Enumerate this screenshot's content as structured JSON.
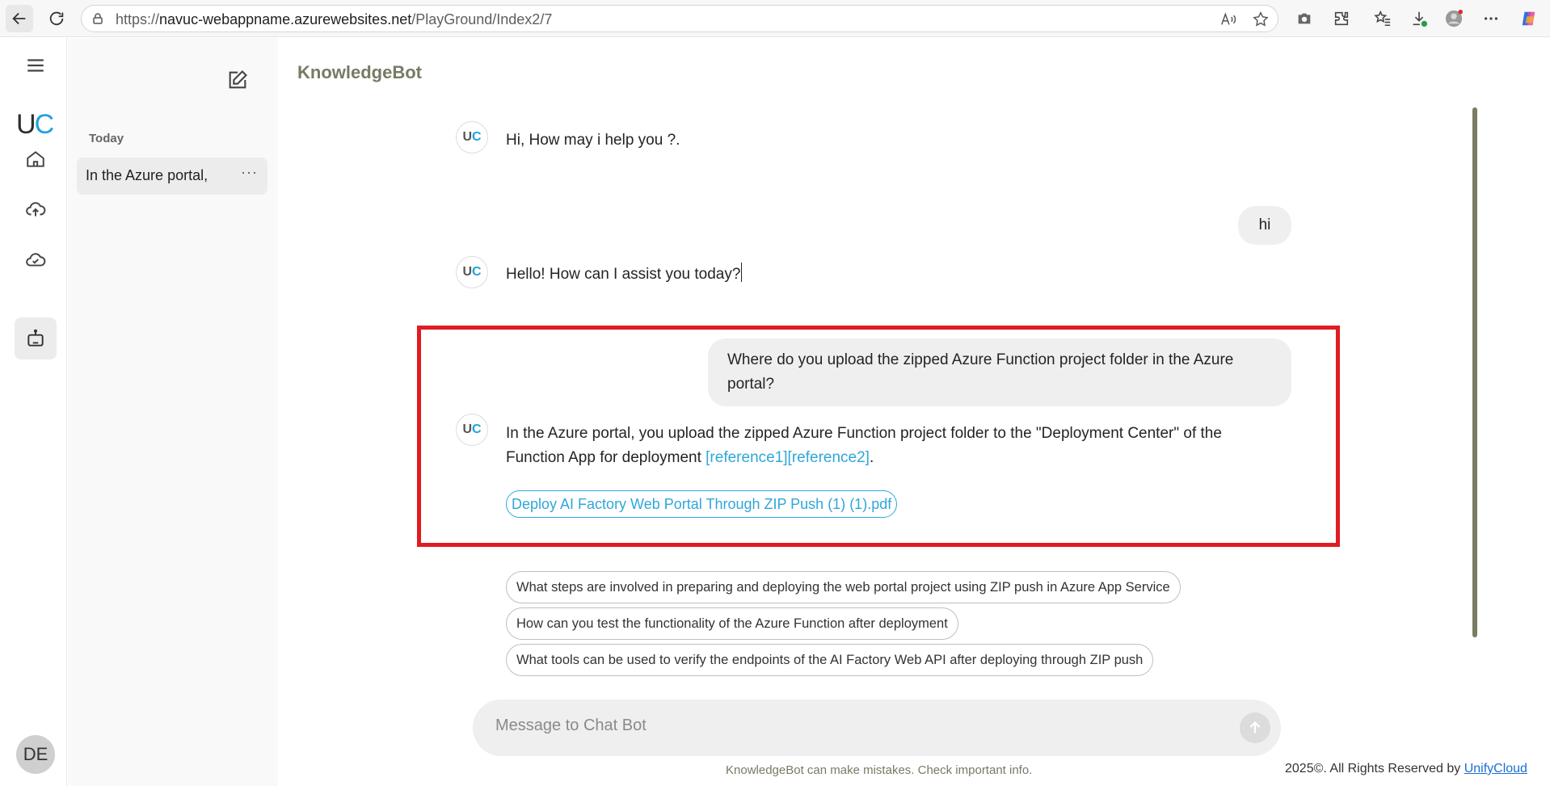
{
  "browser": {
    "url_prefix": "https://",
    "url_host": "navuc-webappname.azurewebsites.net",
    "url_path": "/PlayGround/Index2/7",
    "icons": [
      "back-arrow-icon",
      "reload-icon",
      "lock-icon",
      "read-aloud-icon",
      "favorite-star-icon",
      "screenshot-camera-icon",
      "extensions-icon",
      "favorites-icon",
      "downloads-icon",
      "profile-icon",
      "more-icon",
      "copilot-icon"
    ]
  },
  "rail": {
    "logo_u": "U",
    "logo_c": "C",
    "user_initials": "DE"
  },
  "history": {
    "section_label": "Today",
    "items": [
      {
        "label": "In the Azure portal,",
        "more": "···"
      }
    ]
  },
  "main": {
    "title": "KnowledgeBot",
    "avatar_u": "U",
    "avatar_c": "C",
    "messages": [
      {
        "role": "bot",
        "text": "Hi, How may i help you ?."
      },
      {
        "role": "user",
        "text": "hi"
      },
      {
        "role": "bot",
        "text": "Hello! How can I assist you today?"
      },
      {
        "role": "user",
        "text": "Where do you upload the zipped Azure Function project folder in the Azure portal?"
      },
      {
        "role": "bot",
        "text_line1": "In the Azure portal, you upload the zipped Azure Function project folder to the \"Deployment Center\" of the",
        "text_line2": "Function App for deployment ",
        "references": "[reference1][reference2]",
        "after_ref": ".",
        "source": "Deploy AI Factory Web Portal Through ZIP Push (1) (1).pdf"
      }
    ],
    "suggestions": [
      "What steps are involved in preparing and deploying the web portal project using ZIP push in Azure App Service",
      "How can you test the functionality of the Azure Function after deployment",
      "What tools can be used to verify the endpoints of the AI Factory Web API after deploying through ZIP push"
    ],
    "composer_placeholder": "Message to Chat Bot",
    "disclaimer": "KnowledgeBot can make mistakes. Check important info.",
    "copyright_text": "2025©. All Rights Reserved by ",
    "copyright_link": "UnifyCloud"
  },
  "colors": {
    "accent_blue": "#1ea1df",
    "title_olive": "#767b63",
    "highlight_red": "#e01c23"
  }
}
